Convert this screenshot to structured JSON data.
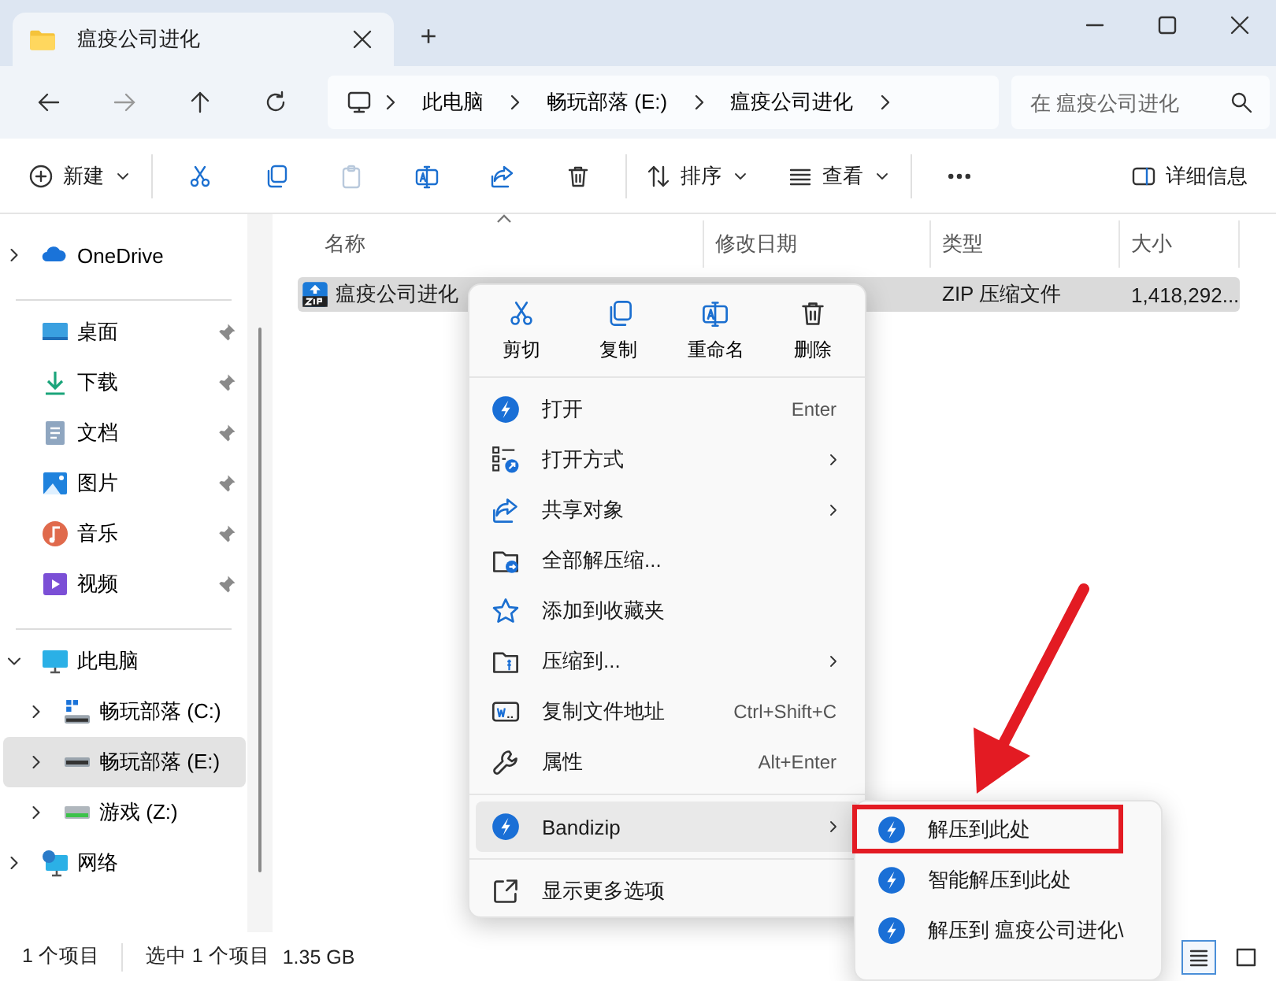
{
  "window": {
    "tab_title": "瘟疫公司进化",
    "new_tab": "+"
  },
  "address": {
    "breadcrumbs": [
      "此电脑",
      "畅玩部落 (E:)",
      "瘟疫公司进化"
    ],
    "search": {
      "placeholder": "在 瘟疫公司进化"
    }
  },
  "toolbar": {
    "new": "新建",
    "sort": "排序",
    "view": "查看",
    "details": "详细信息"
  },
  "sidebar": {
    "groups": [
      [
        {
          "label": "OneDrive",
          "kind": "cloud",
          "expanded": false,
          "selected": false
        }
      ],
      [
        {
          "label": "桌面",
          "kind": "desktop",
          "pinned": true,
          "selected": false
        },
        {
          "label": "下载",
          "kind": "download",
          "pinned": true,
          "selected": false
        },
        {
          "label": "文档",
          "kind": "document",
          "pinned": true,
          "selected": false
        },
        {
          "label": "图片",
          "kind": "image",
          "pinned": true,
          "selected": false
        },
        {
          "label": "音乐",
          "kind": "music",
          "pinned": true,
          "selected": false
        },
        {
          "label": "视频",
          "kind": "video",
          "pinned": true,
          "selected": false
        }
      ],
      [
        {
          "label": "此电脑",
          "kind": "pc",
          "expanded": true,
          "selected": false,
          "children": [
            {
              "label": "畅玩部落 (C:)",
              "kind": "systemdrive",
              "expanded": false,
              "selected": false
            },
            {
              "label": "畅玩部落 (E:)",
              "kind": "drive",
              "expanded": false,
              "selected": true
            },
            {
              "label": "游戏 (Z:)",
              "kind": "greendrive",
              "expanded": false,
              "selected": false
            }
          ]
        },
        {
          "label": "网络",
          "kind": "network",
          "expanded": false,
          "selected": false
        }
      ]
    ]
  },
  "table": {
    "columns": [
      {
        "label": "名称",
        "sorted": true
      },
      {
        "label": "修改日期",
        "sorted": false
      },
      {
        "label": "类型",
        "sorted": false
      },
      {
        "label": "大小",
        "sorted": false
      }
    ],
    "rows": [
      {
        "name": "瘟疫公司进化",
        "type": "ZIP 压缩文件",
        "size": "1,418,292...",
        "selected": true
      }
    ]
  },
  "context_menu": {
    "quick_actions": [
      {
        "label": "剪切",
        "kind": "cut"
      },
      {
        "label": "复制",
        "kind": "copy"
      },
      {
        "label": "重命名",
        "kind": "rename"
      },
      {
        "label": "删除",
        "kind": "delete"
      }
    ],
    "groups": [
      [
        {
          "label": "打开",
          "kind": "bandizip",
          "shortcut": "Enter",
          "submenu": false,
          "selected": false
        },
        {
          "label": "打开方式",
          "kind": "openwith",
          "submenu": true,
          "selected": false
        },
        {
          "label": "共享对象",
          "kind": "share",
          "submenu": true,
          "selected": false
        },
        {
          "label": "全部解压缩...",
          "kind": "extract",
          "submenu": false,
          "selected": false
        },
        {
          "label": "添加到收藏夹",
          "kind": "star",
          "submenu": false,
          "selected": false
        },
        {
          "label": "压缩到...",
          "kind": "zip",
          "submenu": true,
          "selected": false
        },
        {
          "label": "复制文件地址",
          "kind": "path",
          "shortcut": "Ctrl+Shift+C",
          "submenu": false,
          "selected": false
        },
        {
          "label": "属性",
          "kind": "wrench",
          "shortcut": "Alt+Enter",
          "submenu": false,
          "selected": false
        }
      ],
      [
        {
          "label": "Bandizip",
          "kind": "bandizip",
          "submenu": true,
          "selected": true
        }
      ],
      [
        {
          "label": "显示更多选项",
          "kind": "more",
          "submenu": false,
          "selected": false
        }
      ]
    ]
  },
  "submenu": {
    "items": [
      {
        "label": "解压到此处",
        "marked": true
      },
      {
        "label": "智能解压到此处",
        "marked": false
      },
      {
        "label": "解压到 瘟疫公司进化\\",
        "marked": false
      }
    ]
  },
  "status_bar": {
    "texts": [
      "1 个项目",
      "选中 1 个项目",
      "1.35 GB"
    ],
    "views": [
      {
        "kind": "details",
        "selected": true
      },
      {
        "kind": "tiles",
        "selected": false
      }
    ]
  }
}
